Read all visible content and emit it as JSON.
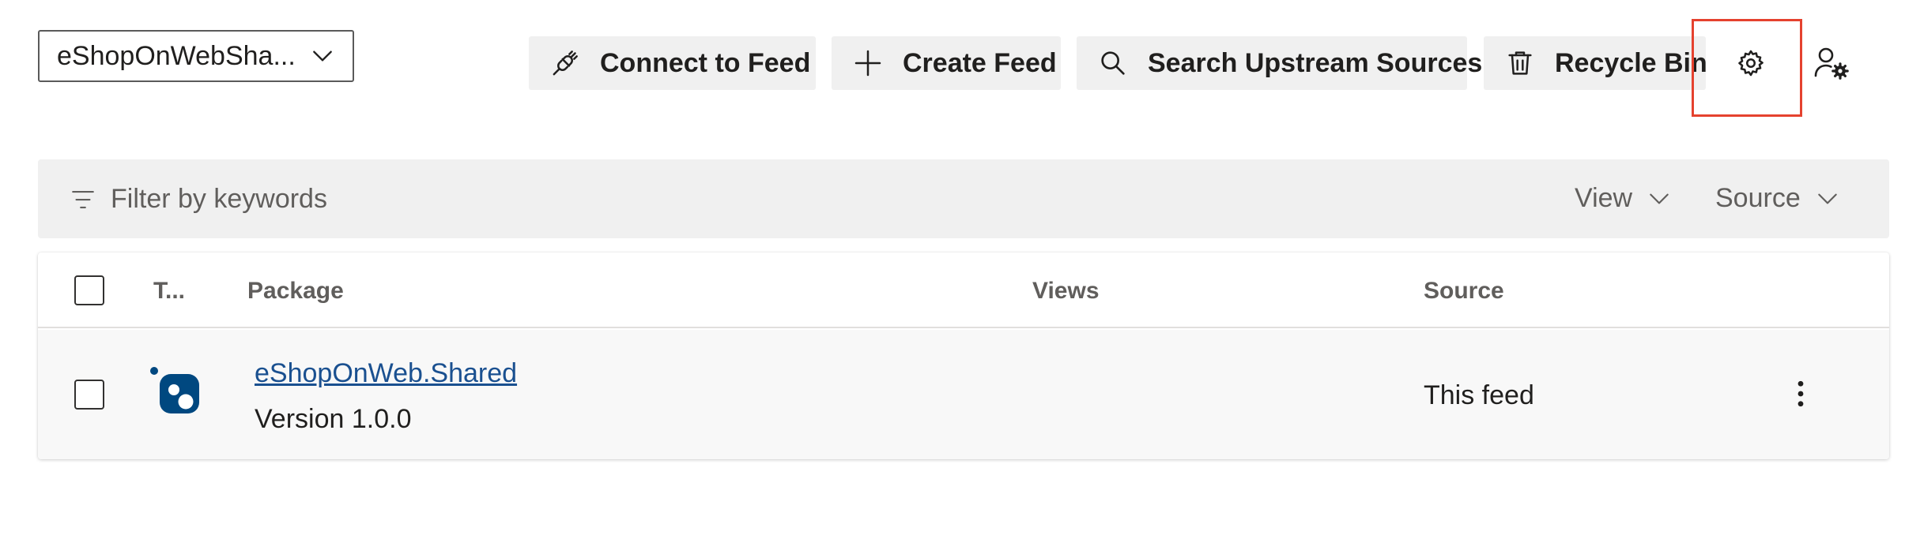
{
  "feed_selector": {
    "value": "eShopOnWebSha..."
  },
  "toolbar": {
    "connect_label": "Connect to Feed",
    "create_label": "Create Feed",
    "search_label": "Search Upstream Sources",
    "recycle_label": "Recycle Bin",
    "icons": {
      "connect": "plug-icon",
      "create": "plus-icon",
      "search": "search-icon",
      "recycle": "trash-icon",
      "settings": "gear-icon",
      "permissions": "user-settings-icon"
    }
  },
  "filter": {
    "placeholder": "Filter by keywords",
    "view_label": "View",
    "source_label": "Source"
  },
  "table": {
    "columns": {
      "type": "T...",
      "package": "Package",
      "views": "Views",
      "source": "Source"
    },
    "rows": [
      {
        "name": "eShopOnWeb.Shared",
        "version": "Version 1.0.0",
        "views": "",
        "source": "This feed",
        "type_icon": "nuget-icon"
      }
    ]
  },
  "colors": {
    "accent_link": "#1a5090",
    "highlight": "#e5422f",
    "nuget_blue": "#004880"
  }
}
